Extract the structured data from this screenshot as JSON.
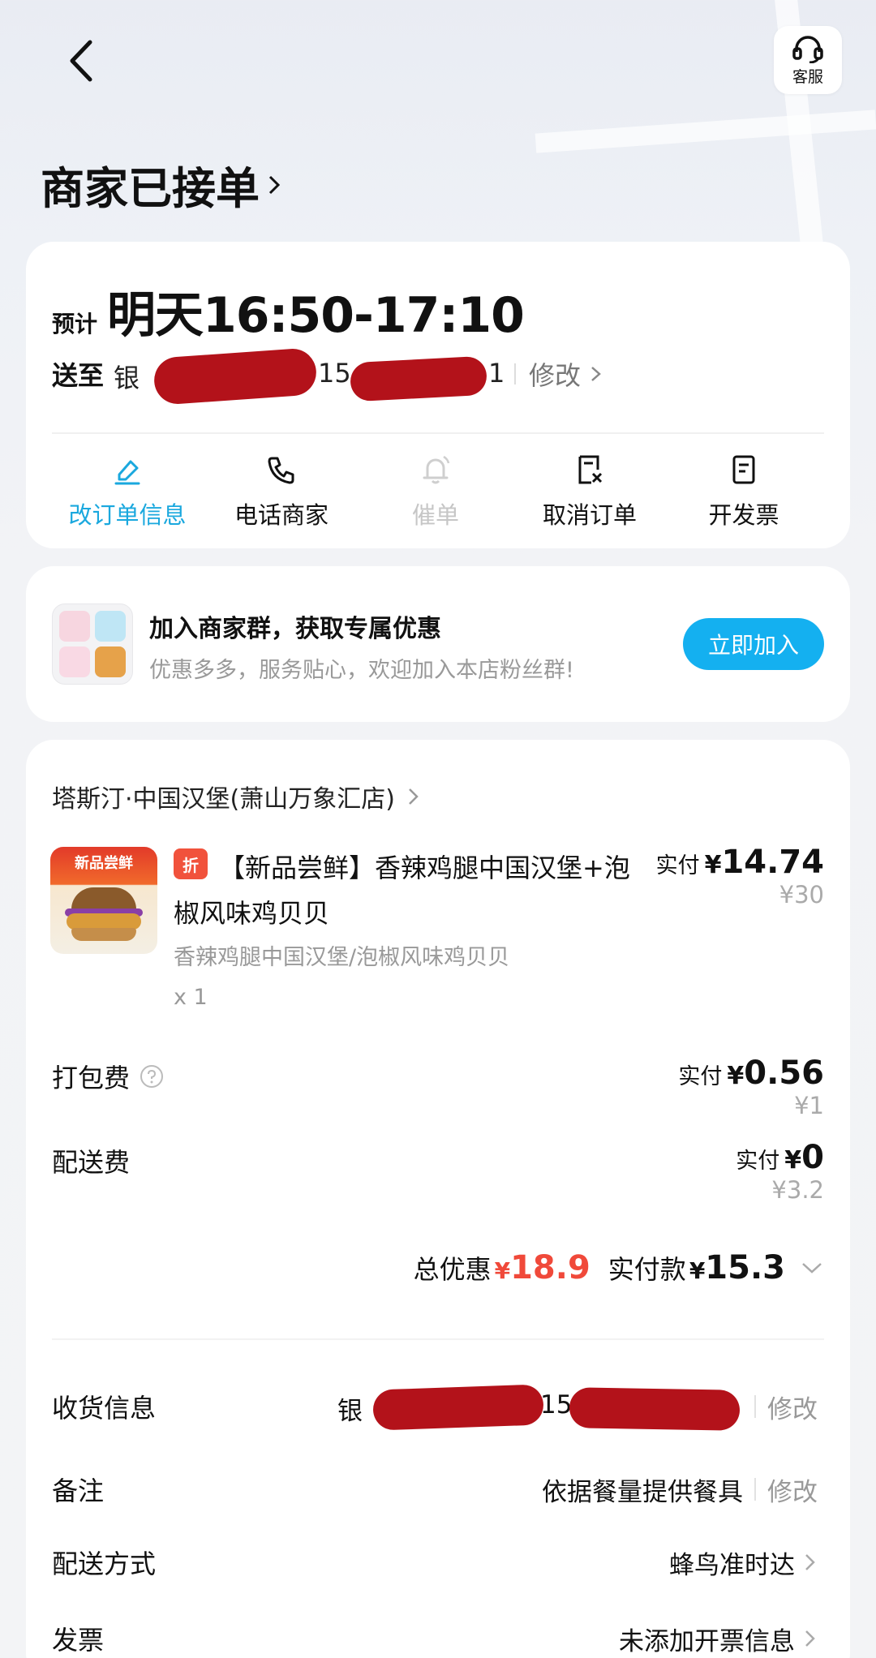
{
  "header": {
    "customer_service_label": "客服",
    "status_title": "商家已接单"
  },
  "delivery": {
    "eta_label": "预计",
    "eta_time": "明天16:50-17:10",
    "address_label": "送至",
    "address_prefix": "银",
    "phone_start": "15",
    "phone_end": "1",
    "edit_label": "修改"
  },
  "actions": [
    {
      "label": "改订单信息",
      "icon": "edit-icon",
      "state": "active"
    },
    {
      "label": "电话商家",
      "icon": "phone-icon",
      "state": "normal"
    },
    {
      "label": "催单",
      "icon": "bell-icon",
      "state": "disabled"
    },
    {
      "label": "取消订单",
      "icon": "cancel-doc-icon",
      "state": "normal"
    },
    {
      "label": "开发票",
      "icon": "invoice-icon",
      "state": "normal"
    }
  ],
  "group_promo": {
    "title": "加入商家群，获取专属优惠",
    "subtitle": "优惠多多，服务贴心，欢迎加入本店粉丝群!",
    "button": "立即加入"
  },
  "order": {
    "store_name": "塔斯汀·中国汉堡(萧山万象汇店)",
    "item": {
      "image_tag": "新品尝鲜",
      "discount_badge": "折",
      "name": "【新品尝鲜】香辣鸡腿中国汉堡+泡椒风味鸡贝贝",
      "spec": "香辣鸡腿中国汉堡/泡椒风味鸡贝贝",
      "qty": "x 1",
      "paid_label": "实付",
      "currency": "¥",
      "paid": "14.74",
      "original": "¥30"
    },
    "packing_fee": {
      "label": "打包费",
      "paid_label": "实付",
      "currency": "¥",
      "paid": "0.56",
      "original": "¥1"
    },
    "delivery_fee": {
      "label": "配送费",
      "paid_label": "实付",
      "currency": "¥",
      "paid": "0",
      "original": "¥3.2"
    },
    "summary": {
      "discount_label": "总优惠",
      "currency": "¥",
      "discount": "18.9",
      "paid_label": "实付款",
      "paid": "15.3"
    }
  },
  "info_rows": {
    "receiver": {
      "label": "收货信息",
      "value_prefix": "银",
      "value_mid": "15",
      "edit": "修改"
    },
    "remark": {
      "label": "备注",
      "value": "依据餐量提供餐具",
      "edit": "修改"
    },
    "delivery_method": {
      "label": "配送方式",
      "value": "蜂鸟准时达"
    },
    "invoice": {
      "label": "发票",
      "value": "未添加开票信息"
    }
  },
  "colors": {
    "accent_blue": "#14b0f0",
    "active_action": "#1aa8de",
    "discount_red": "#f0493a",
    "redaction": "#b3121a"
  }
}
